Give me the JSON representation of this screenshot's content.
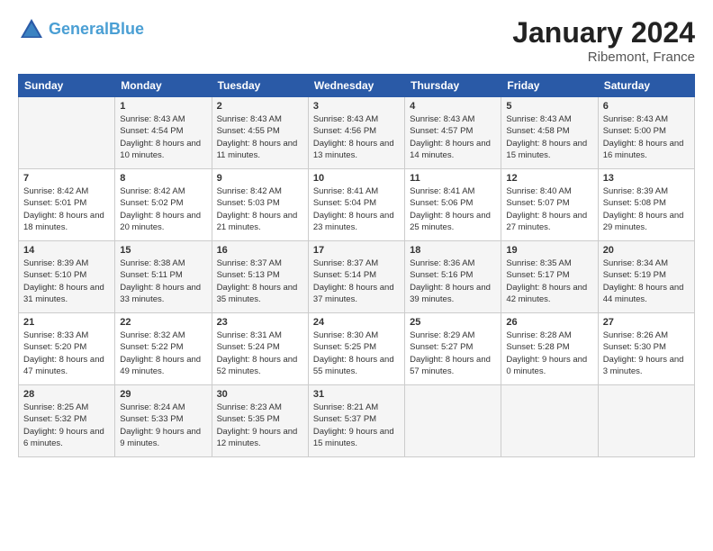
{
  "logo": {
    "line1": "General",
    "line2": "Blue"
  },
  "title": "January 2024",
  "location": "Ribemont, France",
  "days_header": [
    "Sunday",
    "Monday",
    "Tuesday",
    "Wednesday",
    "Thursday",
    "Friday",
    "Saturday"
  ],
  "weeks": [
    [
      {
        "day": "",
        "sunrise": "",
        "sunset": "",
        "daylight": ""
      },
      {
        "day": "1",
        "sunrise": "Sunrise: 8:43 AM",
        "sunset": "Sunset: 4:54 PM",
        "daylight": "Daylight: 8 hours and 10 minutes."
      },
      {
        "day": "2",
        "sunrise": "Sunrise: 8:43 AM",
        "sunset": "Sunset: 4:55 PM",
        "daylight": "Daylight: 8 hours and 11 minutes."
      },
      {
        "day": "3",
        "sunrise": "Sunrise: 8:43 AM",
        "sunset": "Sunset: 4:56 PM",
        "daylight": "Daylight: 8 hours and 13 minutes."
      },
      {
        "day": "4",
        "sunrise": "Sunrise: 8:43 AM",
        "sunset": "Sunset: 4:57 PM",
        "daylight": "Daylight: 8 hours and 14 minutes."
      },
      {
        "day": "5",
        "sunrise": "Sunrise: 8:43 AM",
        "sunset": "Sunset: 4:58 PM",
        "daylight": "Daylight: 8 hours and 15 minutes."
      },
      {
        "day": "6",
        "sunrise": "Sunrise: 8:43 AM",
        "sunset": "Sunset: 5:00 PM",
        "daylight": "Daylight: 8 hours and 16 minutes."
      }
    ],
    [
      {
        "day": "7",
        "sunrise": "Sunrise: 8:42 AM",
        "sunset": "Sunset: 5:01 PM",
        "daylight": "Daylight: 8 hours and 18 minutes."
      },
      {
        "day": "8",
        "sunrise": "Sunrise: 8:42 AM",
        "sunset": "Sunset: 5:02 PM",
        "daylight": "Daylight: 8 hours and 20 minutes."
      },
      {
        "day": "9",
        "sunrise": "Sunrise: 8:42 AM",
        "sunset": "Sunset: 5:03 PM",
        "daylight": "Daylight: 8 hours and 21 minutes."
      },
      {
        "day": "10",
        "sunrise": "Sunrise: 8:41 AM",
        "sunset": "Sunset: 5:04 PM",
        "daylight": "Daylight: 8 hours and 23 minutes."
      },
      {
        "day": "11",
        "sunrise": "Sunrise: 8:41 AM",
        "sunset": "Sunset: 5:06 PM",
        "daylight": "Daylight: 8 hours and 25 minutes."
      },
      {
        "day": "12",
        "sunrise": "Sunrise: 8:40 AM",
        "sunset": "Sunset: 5:07 PM",
        "daylight": "Daylight: 8 hours and 27 minutes."
      },
      {
        "day": "13",
        "sunrise": "Sunrise: 8:39 AM",
        "sunset": "Sunset: 5:08 PM",
        "daylight": "Daylight: 8 hours and 29 minutes."
      }
    ],
    [
      {
        "day": "14",
        "sunrise": "Sunrise: 8:39 AM",
        "sunset": "Sunset: 5:10 PM",
        "daylight": "Daylight: 8 hours and 31 minutes."
      },
      {
        "day": "15",
        "sunrise": "Sunrise: 8:38 AM",
        "sunset": "Sunset: 5:11 PM",
        "daylight": "Daylight: 8 hours and 33 minutes."
      },
      {
        "day": "16",
        "sunrise": "Sunrise: 8:37 AM",
        "sunset": "Sunset: 5:13 PM",
        "daylight": "Daylight: 8 hours and 35 minutes."
      },
      {
        "day": "17",
        "sunrise": "Sunrise: 8:37 AM",
        "sunset": "Sunset: 5:14 PM",
        "daylight": "Daylight: 8 hours and 37 minutes."
      },
      {
        "day": "18",
        "sunrise": "Sunrise: 8:36 AM",
        "sunset": "Sunset: 5:16 PM",
        "daylight": "Daylight: 8 hours and 39 minutes."
      },
      {
        "day": "19",
        "sunrise": "Sunrise: 8:35 AM",
        "sunset": "Sunset: 5:17 PM",
        "daylight": "Daylight: 8 hours and 42 minutes."
      },
      {
        "day": "20",
        "sunrise": "Sunrise: 8:34 AM",
        "sunset": "Sunset: 5:19 PM",
        "daylight": "Daylight: 8 hours and 44 minutes."
      }
    ],
    [
      {
        "day": "21",
        "sunrise": "Sunrise: 8:33 AM",
        "sunset": "Sunset: 5:20 PM",
        "daylight": "Daylight: 8 hours and 47 minutes."
      },
      {
        "day": "22",
        "sunrise": "Sunrise: 8:32 AM",
        "sunset": "Sunset: 5:22 PM",
        "daylight": "Daylight: 8 hours and 49 minutes."
      },
      {
        "day": "23",
        "sunrise": "Sunrise: 8:31 AM",
        "sunset": "Sunset: 5:24 PM",
        "daylight": "Daylight: 8 hours and 52 minutes."
      },
      {
        "day": "24",
        "sunrise": "Sunrise: 8:30 AM",
        "sunset": "Sunset: 5:25 PM",
        "daylight": "Daylight: 8 hours and 55 minutes."
      },
      {
        "day": "25",
        "sunrise": "Sunrise: 8:29 AM",
        "sunset": "Sunset: 5:27 PM",
        "daylight": "Daylight: 8 hours and 57 minutes."
      },
      {
        "day": "26",
        "sunrise": "Sunrise: 8:28 AM",
        "sunset": "Sunset: 5:28 PM",
        "daylight": "Daylight: 9 hours and 0 minutes."
      },
      {
        "day": "27",
        "sunrise": "Sunrise: 8:26 AM",
        "sunset": "Sunset: 5:30 PM",
        "daylight": "Daylight: 9 hours and 3 minutes."
      }
    ],
    [
      {
        "day": "28",
        "sunrise": "Sunrise: 8:25 AM",
        "sunset": "Sunset: 5:32 PM",
        "daylight": "Daylight: 9 hours and 6 minutes."
      },
      {
        "day": "29",
        "sunrise": "Sunrise: 8:24 AM",
        "sunset": "Sunset: 5:33 PM",
        "daylight": "Daylight: 9 hours and 9 minutes."
      },
      {
        "day": "30",
        "sunrise": "Sunrise: 8:23 AM",
        "sunset": "Sunset: 5:35 PM",
        "daylight": "Daylight: 9 hours and 12 minutes."
      },
      {
        "day": "31",
        "sunrise": "Sunrise: 8:21 AM",
        "sunset": "Sunset: 5:37 PM",
        "daylight": "Daylight: 9 hours and 15 minutes."
      },
      {
        "day": "",
        "sunrise": "",
        "sunset": "",
        "daylight": ""
      },
      {
        "day": "",
        "sunrise": "",
        "sunset": "",
        "daylight": ""
      },
      {
        "day": "",
        "sunrise": "",
        "sunset": "",
        "daylight": ""
      }
    ]
  ]
}
